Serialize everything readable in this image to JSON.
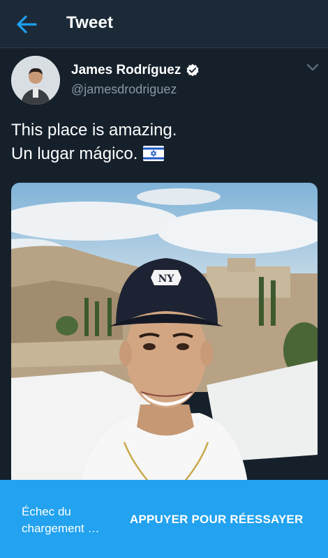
{
  "header": {
    "title": "Tweet",
    "back_icon": "arrow-left-icon",
    "accent_color": "#1da1f2"
  },
  "tweet": {
    "author_name": "James Rodríguez",
    "author_handle": "@jamesdrodriguez",
    "verified": true,
    "text_line1": "This place is amazing.",
    "text_line2": "Un lugar mágico.",
    "flag": "israel-flag",
    "image_alt": "Selfie of a man in a black NY cap in front of an old stone city"
  },
  "snackbar": {
    "message": "Échec du chargement …",
    "action_label": "APPUYER POUR RÉESSAYER",
    "background": "#22a2ef"
  }
}
